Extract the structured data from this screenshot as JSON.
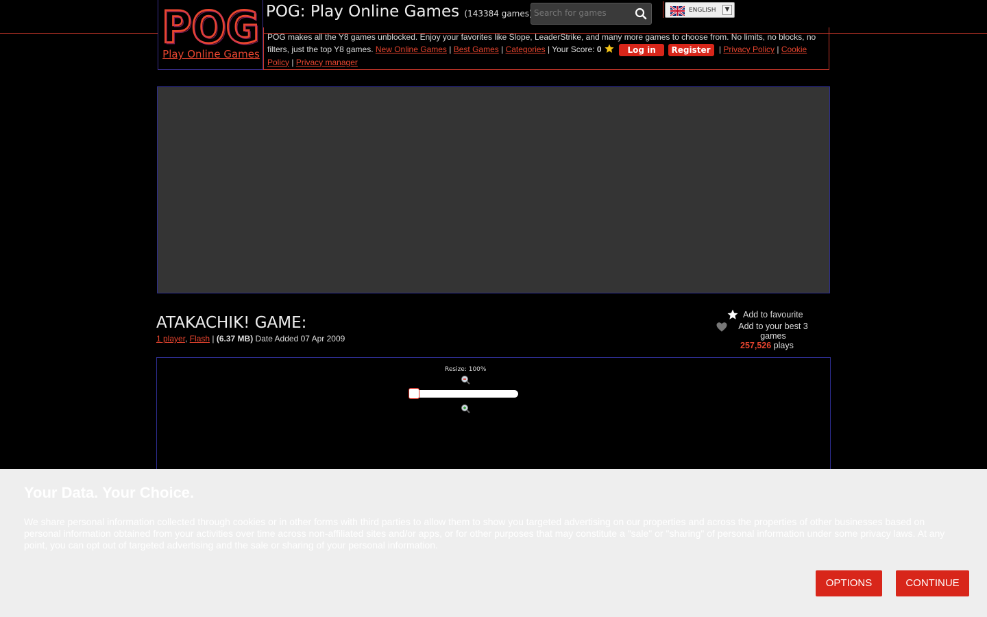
{
  "header": {
    "logo_text": "POG",
    "logo_subtitle": "Play Online Games",
    "site_title": "POG: Play Online Games",
    "games_count": "(143384 games)",
    "search_placeholder": "Search for games",
    "language": "ENGLISH",
    "colors": {
      "accent": "#e8452f",
      "button": "#d8261a",
      "logo_glow": "#b0287a"
    }
  },
  "info_bar": {
    "description": "POG makes all the Y8 games unblocked. Enjoy your favorites like Slope, LeaderStrike, and many more games to choose from. No limits, no blocks, no filters, just the top Y8 games.",
    "links": {
      "new_games": "New Online Games",
      "best_games": "Best Games",
      "categories": "Categories"
    },
    "score_label": "Your Score:",
    "score_value": "0",
    "login_label": "Log in",
    "register_label": "Register",
    "privacy_policy": "Privacy Policy",
    "cookie_policy": "Cookie Policy",
    "privacy_manager": "Privacy manager",
    "separator": "|"
  },
  "game": {
    "title": "ATAKACHIK! GAME:",
    "players": "1 player",
    "tech": "Flash",
    "size": "(6.37 MB)",
    "date_added": "Date Added 07 Apr 2009",
    "add_favourite": "Add to favourite",
    "add_best": "Add to your best 3 games",
    "plays_count": "257,526",
    "plays_label": "plays",
    "resize_label": "Resize: 100%",
    "resize_value": 0
  },
  "consent": {
    "title": "Your Data. Your Choice.",
    "text": "We share personal information collected through cookies or in other forms with third parties to allow them to show you targeted advertising on our properties and across the properties of other businesses based on personal information obtained from your activities over time across non-affiliated sites and/or apps, or for other purposes that may constitute a \"sale\" or \"sharing\" of personal information under some privacy laws. At any point, you can opt out of targeted advertising and the sale or sharing of your personal information.",
    "options_label": "OPTIONS",
    "continue_label": "CONTINUE"
  }
}
